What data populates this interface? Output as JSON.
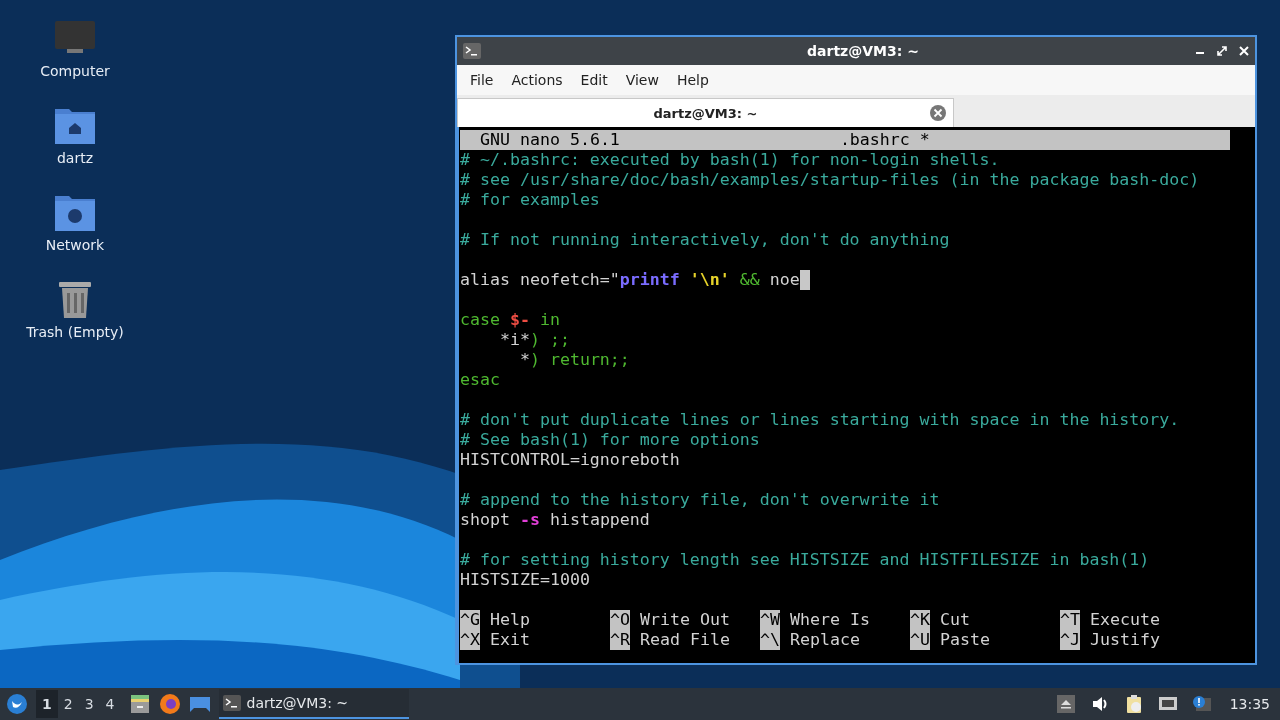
{
  "desktop_icons": [
    {
      "label": "Computer",
      "kind": "computer"
    },
    {
      "label": "dartz",
      "kind": "home"
    },
    {
      "label": "Network",
      "kind": "network"
    },
    {
      "label": "Trash (Empty)",
      "kind": "trash"
    }
  ],
  "terminal": {
    "title": "dartz@VM3: ~",
    "menu": [
      "File",
      "Actions",
      "Edit",
      "View",
      "Help"
    ],
    "tabs": [
      {
        "label": "dartz@VM3: ~",
        "selected": true
      }
    ],
    "nano": {
      "version": "GNU nano 5.6.1",
      "filename": ".bashrc *",
      "lines": [
        {
          "kind": "code",
          "cursor": false,
          "segments": [
            {
              "kind": "comment",
              "text": "# ~/.bashrc: executed by bash(1) for non-login shells."
            }
          ]
        },
        {
          "kind": "code",
          "cursor": false,
          "segments": [
            {
              "kind": "comment",
              "text": "# see /usr/share/doc/bash/examples/startup-files (in the package bash-doc)"
            }
          ]
        },
        {
          "kind": "code",
          "cursor": false,
          "segments": [
            {
              "kind": "comment",
              "text": "# for examples"
            }
          ]
        },
        {
          "kind": "blank"
        },
        {
          "kind": "code",
          "cursor": false,
          "segments": [
            {
              "kind": "comment",
              "text": "# If not running interactively, don't do anything"
            }
          ]
        },
        {
          "kind": "blank"
        },
        {
          "kind": "code",
          "cursor": true,
          "segments": [
            {
              "kind": "plain",
              "text": "alias neofetch=\""
            },
            {
              "kind": "command",
              "text": "printf"
            },
            {
              "kind": "string",
              "text": " '\\n'"
            },
            {
              "kind": "operator",
              "text": " &&"
            },
            {
              "kind": "plain",
              "text": " noe"
            }
          ]
        },
        {
          "kind": "blank"
        },
        {
          "kind": "code",
          "cursor": false,
          "segments": [
            {
              "kind": "keyword",
              "text": "case "
            },
            {
              "kind": "variable",
              "text": "$-"
            },
            {
              "kind": "keyword",
              "text": " in"
            }
          ]
        },
        {
          "kind": "code",
          "cursor": false,
          "segments": [
            {
              "kind": "plain",
              "text": "    *i*"
            },
            {
              "kind": "keyword",
              "text": ") ;;"
            }
          ]
        },
        {
          "kind": "code",
          "cursor": false,
          "segments": [
            {
              "kind": "plain",
              "text": "      *"
            },
            {
              "kind": "keyword",
              "text": ") return;;"
            }
          ]
        },
        {
          "kind": "code",
          "cursor": false,
          "segments": [
            {
              "kind": "keyword",
              "text": "esac"
            }
          ]
        },
        {
          "kind": "blank"
        },
        {
          "kind": "code",
          "cursor": false,
          "segments": [
            {
              "kind": "comment",
              "text": "# don't put duplicate lines or lines starting with space in the history."
            }
          ]
        },
        {
          "kind": "code",
          "cursor": false,
          "segments": [
            {
              "kind": "comment",
              "text": "# See bash(1) for more options"
            }
          ]
        },
        {
          "kind": "code",
          "cursor": false,
          "segments": [
            {
              "kind": "plain",
              "text": "HISTCONTROL=ignoreboth"
            }
          ]
        },
        {
          "kind": "blank"
        },
        {
          "kind": "code",
          "cursor": false,
          "segments": [
            {
              "kind": "comment",
              "text": "# append to the history file, don't overwrite it"
            }
          ]
        },
        {
          "kind": "code",
          "cursor": false,
          "segments": [
            {
              "kind": "plain",
              "text": "shopt "
            },
            {
              "kind": "flag",
              "text": "-s"
            },
            {
              "kind": "plain",
              "text": " histappend"
            }
          ]
        },
        {
          "kind": "blank"
        },
        {
          "kind": "code",
          "cursor": false,
          "segments": [
            {
              "kind": "comment",
              "text": "# for setting history length see HISTSIZE and HISTFILESIZE in bash(1)"
            }
          ]
        },
        {
          "kind": "code",
          "cursor": false,
          "segments": [
            {
              "kind": "plain",
              "text": "HISTSIZE=1000"
            }
          ]
        },
        {
          "kind": "blank"
        }
      ],
      "shortcut_rows": [
        [
          {
            "key": "^G",
            "label": "Help"
          },
          {
            "key": "^O",
            "label": "Write Out"
          },
          {
            "key": "^W",
            "label": "Where Is"
          },
          {
            "key": "^K",
            "label": "Cut"
          },
          {
            "key": "^T",
            "label": "Execute"
          }
        ],
        [
          {
            "key": "^X",
            "label": "Exit"
          },
          {
            "key": "^R",
            "label": "Read File"
          },
          {
            "key": "^\\",
            "label": "Replace"
          },
          {
            "key": "^U",
            "label": "Paste"
          },
          {
            "key": "^J",
            "label": "Justify"
          }
        ]
      ]
    }
  },
  "taskbar": {
    "workspaces": [
      {
        "label": "1",
        "selected": true
      },
      {
        "label": "2",
        "selected": false
      },
      {
        "label": "3",
        "selected": false
      },
      {
        "label": "4",
        "selected": false
      }
    ],
    "tasks": [
      {
        "label": "dartz@VM3: ~",
        "selected": true
      }
    ],
    "clock": "13:35"
  }
}
